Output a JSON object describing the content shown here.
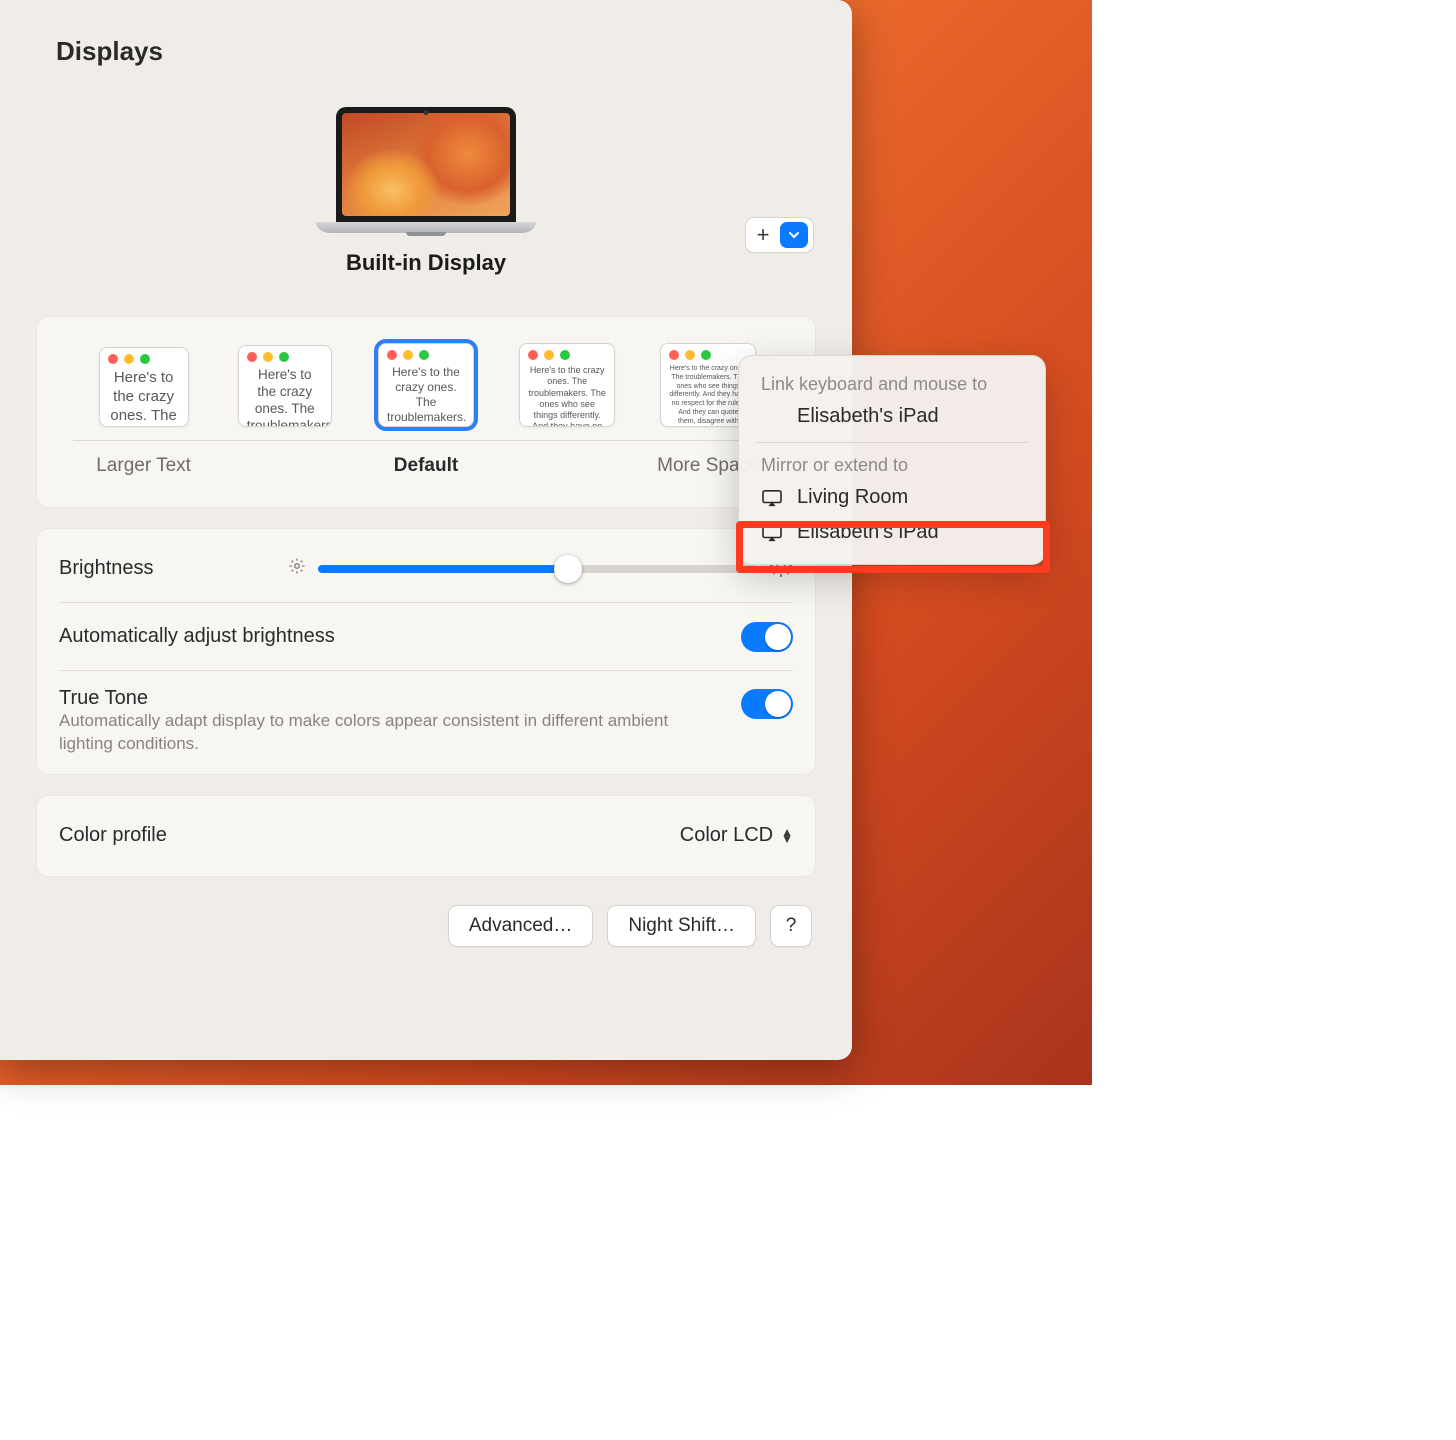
{
  "window": {
    "title": "Displays"
  },
  "device": {
    "name": "Built-in Display"
  },
  "addMenu": {
    "section1_title": "Link keyboard and mouse to",
    "section1_item": "Elisabeth's iPad",
    "section2_title": "Mirror or extend to",
    "section2_item1": "Living Room",
    "section2_item2": "Elisabeth's iPad"
  },
  "resolution": {
    "options": [
      {
        "caption": "Larger Text",
        "selected": false,
        "size": 0
      },
      {
        "caption": "",
        "selected": false,
        "size": 1
      },
      {
        "caption": "Default",
        "selected": true,
        "size": 2
      },
      {
        "caption": "",
        "selected": false,
        "size": 3
      },
      {
        "caption": "More Space",
        "selected": false,
        "size": 4
      }
    ],
    "sample_text": "Here's to the crazy ones. The troublemakers. The ones who see things differently. And they have no respect for the rules. And they can quote them, disagree with them. About the only thing you can't do is ignore them. Because they change things."
  },
  "brightness": {
    "label": "Brightness",
    "value_pct": 57
  },
  "autoAdjust": {
    "label": "Automatically adjust brightness",
    "on": true
  },
  "trueTone": {
    "label": "True Tone",
    "desc": "Automatically adapt display to make colors appear consistent in different ambient lighting conditions.",
    "on": true
  },
  "colorProfile": {
    "label": "Color profile",
    "value": "Color LCD"
  },
  "footer": {
    "advanced": "Advanced…",
    "nightShift": "Night Shift…",
    "help": "?"
  }
}
